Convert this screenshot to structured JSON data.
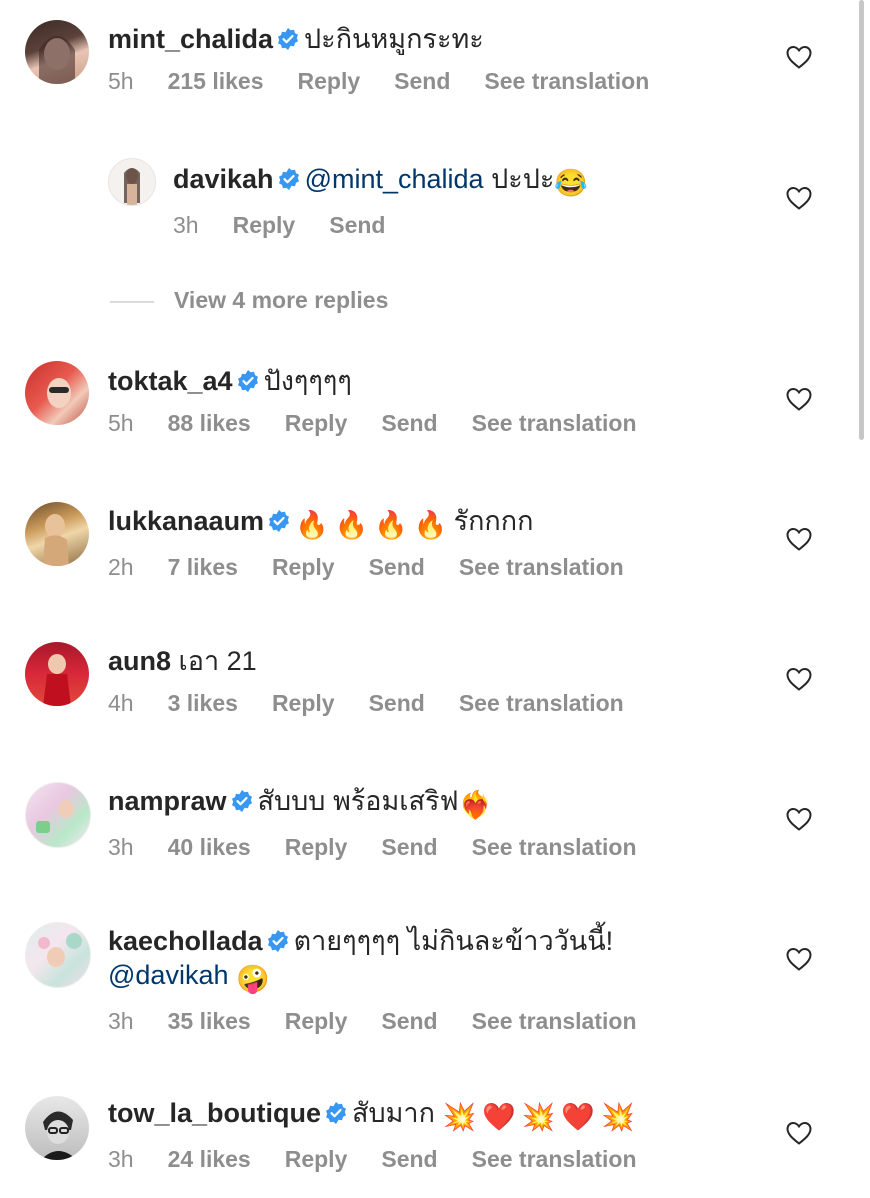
{
  "view_more_replies": "View 4 more replies",
  "comments": [
    {
      "user": "mint_chalida",
      "verified": true,
      "text": "ปะกินหมูกระทะ",
      "time": "5h",
      "likes": "215 likes",
      "reply": "Reply",
      "send": "Send",
      "translate": "See translation"
    },
    {
      "user": "davikah",
      "verified": true,
      "mention": "@mint_chalida",
      "text": " ปะปะ",
      "emoji": "😂",
      "time": "3h",
      "reply": "Reply",
      "send": "Send"
    },
    {
      "user": "toktak_a4",
      "verified": true,
      "text": "ปังๆๆๆๆ",
      "time": "5h",
      "likes": "88 likes",
      "reply": "Reply",
      "send": "Send",
      "translate": "See translation"
    },
    {
      "user": "lukkanaaum",
      "verified": true,
      "emoji": "🔥🔥🔥🔥",
      "text": "รักกกก",
      "time": "2h",
      "likes": "7 likes",
      "reply": "Reply",
      "send": "Send",
      "translate": "See translation"
    },
    {
      "user": "aun8",
      "verified": false,
      "text": "เอา 21",
      "time": "4h",
      "likes": "3 likes",
      "reply": "Reply",
      "send": "Send",
      "translate": "See translation"
    },
    {
      "user": "nampraw",
      "verified": true,
      "text": "สับบบ พร้อมเสริฟ",
      "emoji": "❤️‍🔥",
      "time": "3h",
      "likes": "40 likes",
      "reply": "Reply",
      "send": "Send",
      "translate": "See translation"
    },
    {
      "user": "kaechollada",
      "verified": true,
      "text": "ตายๆๆๆๆ ไม่กินละข้าววันนี้!",
      "mention": "@davikah",
      "emoji": "🤪",
      "time": "3h",
      "likes": "35 likes",
      "reply": "Reply",
      "send": "Send",
      "translate": "See translation"
    },
    {
      "user": "tow_la_boutique",
      "verified": true,
      "text": "สับมาก",
      "emoji": "💥❤️💥❤️💥",
      "time": "3h",
      "likes": "24 likes",
      "reply": "Reply",
      "send": "Send",
      "translate": "See translation"
    }
  ],
  "colors": {
    "text": "#262626",
    "meta": "#8e8e8e",
    "mention": "#00376b",
    "verified": "#3897f0"
  }
}
